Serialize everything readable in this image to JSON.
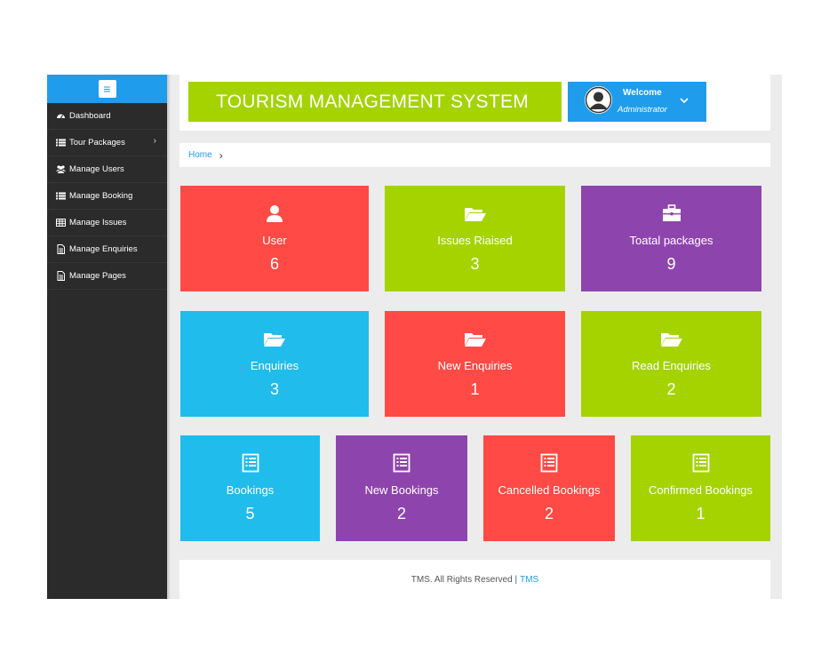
{
  "sidebar": {
    "menu_icon": "hamburger-icon",
    "items": [
      {
        "label": "Dashboard",
        "icon": "dashboard-icon"
      },
      {
        "label": "Tour Packages",
        "icon": "list-icon",
        "has_submenu": true
      },
      {
        "label": "Manage Users",
        "icon": "users-icon"
      },
      {
        "label": "Manage Booking",
        "icon": "list-icon"
      },
      {
        "label": "Manage Issues",
        "icon": "table-icon"
      },
      {
        "label": "Manage Enquiries",
        "icon": "document-icon"
      },
      {
        "label": "Manage Pages",
        "icon": "document-icon"
      }
    ]
  },
  "header": {
    "title": "TOURISM MANAGEMENT SYSTEM",
    "welcome": "Welcome",
    "role": "Administrator"
  },
  "breadcrumb": {
    "home": "Home"
  },
  "tiles": [
    {
      "label": "User",
      "value": "6",
      "color": "#ff4a45",
      "icon": "user-icon"
    },
    {
      "label": "Issues Riaised",
      "value": "3",
      "color": "#a4d300",
      "icon": "folder-open-icon"
    },
    {
      "label": "Toatal packages",
      "value": "9",
      "color": "#8e44ad",
      "icon": "briefcase-icon"
    },
    {
      "label": "Enquiries",
      "value": "3",
      "color": "#1fbcec",
      "icon": "folder-open-icon"
    },
    {
      "label": "New Enquiries",
      "value": "1",
      "color": "#ff4a45",
      "icon": "folder-open-icon"
    },
    {
      "label": "Read Enquiries",
      "value": "2",
      "color": "#a4d300",
      "icon": "folder-open-icon"
    },
    {
      "label": "Bookings",
      "value": "5",
      "color": "#1fbcec",
      "icon": "list-alt-icon"
    },
    {
      "label": "New Bookings",
      "value": "2",
      "color": "#8e44ad",
      "icon": "list-alt-icon"
    },
    {
      "label": "Cancelled Bookings",
      "value": "2",
      "color": "#ff4a45",
      "icon": "list-alt-icon"
    },
    {
      "label": "Confirmed Bookings",
      "value": "1",
      "color": "#a4d300",
      "icon": "list-alt-icon"
    }
  ],
  "footer": {
    "text": "TMS. All Rights Reserved |",
    "link": "TMS"
  }
}
